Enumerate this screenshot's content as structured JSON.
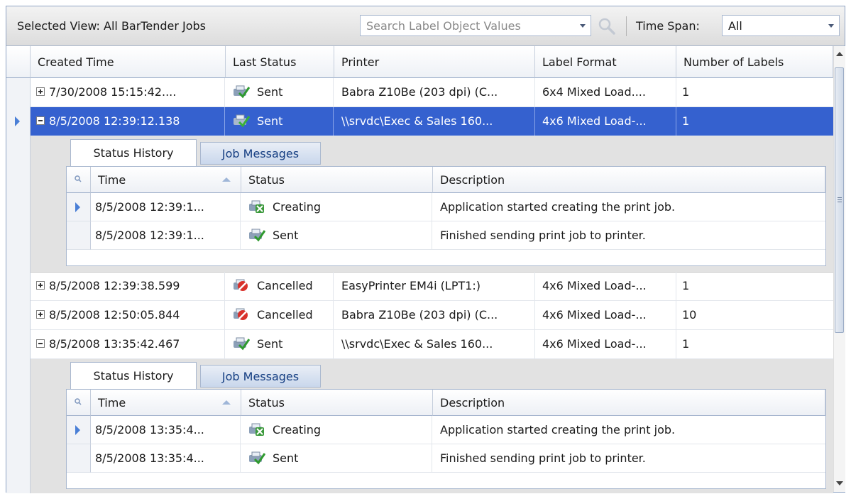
{
  "toolbar": {
    "selected_view": "Selected View: All BarTender Jobs",
    "search_placeholder": "Search Label Object Values",
    "time_span_label": "Time Span:",
    "time_span_value": "All"
  },
  "columns": {
    "created_time": "Created Time",
    "last_status": "Last Status",
    "printer": "Printer",
    "label_format": "Label Format",
    "number_of_labels": "Number of Labels"
  },
  "jobs": [
    {
      "created": "7/30/2008 15:15:42....",
      "status": "Sent",
      "printer": "Babra Z10Be (203 dpi) (C...",
      "format": "6x4 Mixed Load....",
      "labels": "1"
    },
    {
      "created": "8/5/2008 12:39:12.138",
      "status": "Sent",
      "printer": "\\\\srvdc\\Exec & Sales 160...",
      "format": "4x6 Mixed Load-...",
      "labels": "1"
    },
    {
      "created": "8/5/2008 12:39:38.599",
      "status": "Cancelled",
      "printer": "EasyPrinter EM4i (LPT1:)",
      "format": "4x6 Mixed Load-...",
      "labels": "1"
    },
    {
      "created": "8/5/2008 12:50:05.844",
      "status": "Cancelled",
      "printer": "Babra Z10Be (203 dpi) (C...",
      "format": "4x6 Mixed Load-...",
      "labels": "10"
    },
    {
      "created": "8/5/2008 13:35:42.467",
      "status": "Sent",
      "printer": "\\\\srvdc\\Exec & Sales 160...",
      "format": "4x6 Mixed Load-...",
      "labels": "1"
    }
  ],
  "detail_tabs": {
    "status_history": "Status History",
    "job_messages": "Job Messages"
  },
  "sub_columns": {
    "time": "Time",
    "status": "Status",
    "description": "Description"
  },
  "details": [
    {
      "rows": [
        {
          "time": "8/5/2008 12:39:1...",
          "status": "Creating",
          "description": "Application started creating the print job."
        },
        {
          "time": "8/5/2008 12:39:1...",
          "status": "Sent",
          "description": "Finished sending print job to printer."
        }
      ]
    },
    {
      "rows": [
        {
          "time": "8/5/2008 13:35:4...",
          "status": "Creating",
          "description": "Application started creating the print job."
        },
        {
          "time": "8/5/2008 13:35:4...",
          "status": "Sent",
          "description": "Finished sending print job to printer."
        }
      ]
    }
  ],
  "icons": {
    "sent": "printer-check-icon",
    "cancelled": "cancel-icon",
    "creating": "printer-creating-icon",
    "search": "search-icon"
  },
  "colors": {
    "selected_row": "#3561cf",
    "row_indicator": "#4a7fd6",
    "tab_text": "#153e82"
  }
}
